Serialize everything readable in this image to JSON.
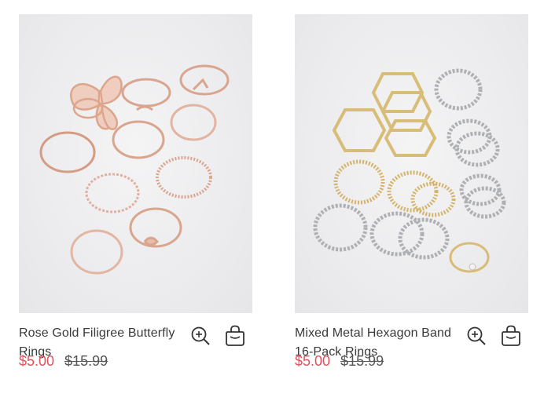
{
  "products": [
    {
      "title": "Rose Gold Filigree Butterfly Rings",
      "price_now": "$5.00",
      "price_was": "$15.99",
      "image_alt": "rose-gold-rings-image",
      "quick_view_icon": "zoom-in-icon",
      "add_to_bag_icon": "shopping-bag-icon"
    },
    {
      "title": "Mixed Metal Hexagon Band 16-Pack Rings",
      "price_now": "$5.00",
      "price_was": "$15.99",
      "image_alt": "mixed-metal-rings-image",
      "quick_view_icon": "zoom-in-icon",
      "add_to_bag_icon": "shopping-bag-icon"
    }
  ],
  "colors": {
    "sale_price": "#e4505c",
    "rose_gold": "#d8a088",
    "gold": "#d4b872",
    "silver": "#a9aaae"
  }
}
